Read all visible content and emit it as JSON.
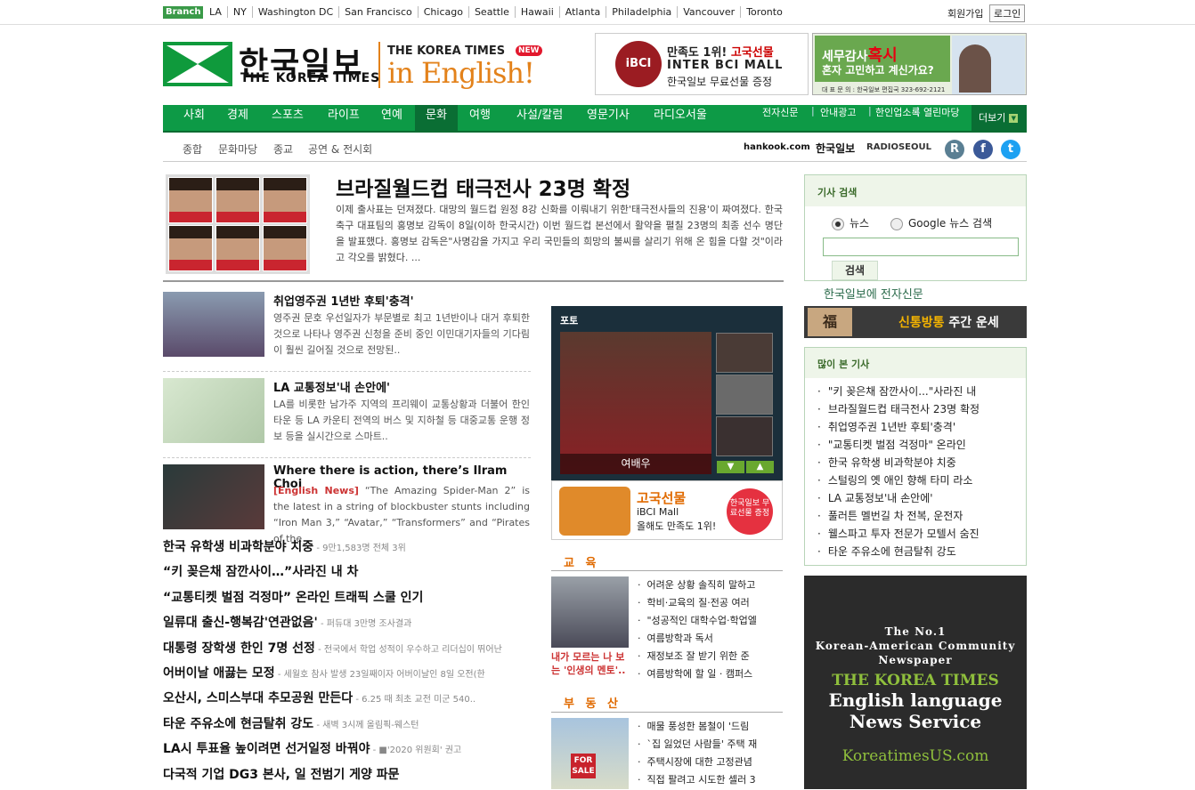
{
  "topbar": {
    "branch": "Branch",
    "cities": [
      "LA",
      "NY",
      "Washington DC",
      "San Francisco",
      "Chicago",
      "Seattle",
      "Hawaii",
      "Atlanta",
      "Philadelphia",
      "Vancouver",
      "Toronto"
    ],
    "join": "회원가입",
    "login": "로그인"
  },
  "logo": {
    "korean": "한국일보",
    "english": "THE KOREA TIMES",
    "sub_title": "THE KOREA TIMES",
    "sub_script": "in English!",
    "new": "NEW"
  },
  "ad1": {
    "mark": "iBCI",
    "line1a": "만족도 1위!",
    "line1b": "고국선물",
    "line2": "INTER BCI MALL",
    "line3": "한국일보 무료선물 증정"
  },
  "ad2": {
    "line1a": "세무감사",
    "line1b": "혹시",
    "line2": "혼자 고민하고 계신가요?",
    "line3": "대 표 문 의 : 한국일보 편집국 323-692-2121"
  },
  "nav": {
    "main": [
      "사회",
      "경제",
      "스포츠",
      "라이프",
      "연예",
      "문화",
      "여행",
      "사설/칼럼",
      "영문기사",
      "라디오서울"
    ],
    "right": [
      "전자신문",
      "안내광고",
      "한인업소록",
      "열린마당"
    ],
    "more": "더보기"
  },
  "subnav": {
    "items": [
      "종합",
      "문화마당",
      "종교",
      "공연 & 전시회"
    ],
    "brands": [
      "hankook.com",
      "한국일보",
      "RADIOSEOUL"
    ]
  },
  "top_story": {
    "title": "브라질월드컵 태극전사 23명 확정",
    "body": "이제 출사표는 던져졌다. 대망의 월드컵 원정 8강 신화를 이뤄내기 위한'태극전사들의 진용'이 짜여졌다. 한국 축구 대표팀의 홍명보 감독이 8일(이하 한국시간) 이번 월드컵 본선에서 활약을 펼칠 23명의 최종 선수 명단을 발표했다. 홍명보 감독은\"사명감을 가지고 우리 국민들의 희망의 불씨를 살리기 위해 온 힘을 다할 것\"이라고 각오를 밝혔다. ..."
  },
  "stories": [
    {
      "title": "취업영주권 1년반 후퇴'충격'",
      "body": "영주권 문호 우선일자가 부문별로 최고 1년반이나 대거 후퇴한 것으로 나타나 영주권 신청을 준비 중인 이민대기자들의 기다림이 훨씬 길어질 것으로 전망된.."
    },
    {
      "title": "LA 교통정보'내 손안에'",
      "body": "LA를 비롯한 남가주 지역의 프리웨이 교통상황과 더불어 한인타운 등 LA 카운티 전역의 버스 및 지하철 등 대중교통 운행 정보 등을 실시간으로 스마트.."
    },
    {
      "title": "Where there is action, there’s Ilram Choi",
      "tag": "[English News]",
      "body": " “The Amazing Spider-Man 2” is the latest in a string of blockbuster stunts including “Iron Man 3,” “Avatar,” “Transformers” and “Pirates of the"
    }
  ],
  "headlines": [
    {
      "h": "한국 유학생 비과학분야 치중",
      "s": " - 9만1,583명 전체 3위"
    },
    {
      "h": "“키 꽂은채 잠깐사이…”사라진 내 차",
      "s": ""
    },
    {
      "h": "“교통티켓 벌점 걱정마” 온라인 트래픽 스쿨 인기",
      "s": ""
    },
    {
      "h": "일류대 출신-행복감'연관없음'",
      "s": " - 퍼듀대 3만명 조사결과"
    },
    {
      "h": "대통령 장학생 한인 7명 선정",
      "s": " - 전국에서 학업 성적이 우수하고 리더십이 뛰어난"
    },
    {
      "h": "어버이날 애끓는 모정",
      "s": " - 세월호 참사 발생 23일째이자 어버이날인 8일 오전(한"
    },
    {
      "h": "오산시, 스미스부대 추모공원 만든다",
      "s": " - 6.25 때 최초 교전 미군 540.."
    },
    {
      "h": "타운 주유소에 현금탈취 강도",
      "s": " - 새벽 3시께 올림픽-웨스턴"
    },
    {
      "h": "LA시 투표율 높이려면 선거일정 바꿔야",
      "s": " - ■'2020 위원회' 권고"
    },
    {
      "h": "다국적 기업 DG3 본사, 일 전범기 게양 파문",
      "s": ""
    }
  ],
  "photo": {
    "label": "포토",
    "caption": "여배우"
  },
  "ad3": {
    "t1": "고국선물",
    "t2": "iBCI Mall",
    "t3": "올해도 만족도 1위!",
    "circle": "한국일보 무료선물 증정"
  },
  "education": {
    "title": "교 육",
    "caption": "내가 모르는 나 보는 '인생의 멘토'..",
    "items": [
      "어려운 상황 솔직히 말하고",
      "학비·교육의 질·전공 여러",
      "\"성공적인 대학수업·학업엘",
      "여름방학과 독서",
      "재정보조 잘 받기 위한 준",
      "여름방학에 할 일 · 캠퍼스"
    ]
  },
  "realestate": {
    "title": "부 동 산",
    "sign": "FOR SALE",
    "items": [
      "매물 풍성한 봄철이 '드림",
      "`집 잃었던 사람들' 주택 재",
      "주택시장에 대한 고정관념",
      "직접 팔려고 시도한 셀러 3"
    ]
  },
  "search": {
    "header": "기사 검색",
    "opt1": "뉴스",
    "opt2": "Google 뉴스 검색",
    "button": "검색"
  },
  "epaper": "한국일보에 전자신문",
  "fortune": {
    "icon": "福",
    "t1": "신통방통",
    "t2": " 주간 운세"
  },
  "popular": {
    "header": "많이 본 기사",
    "items": [
      "\"키 꽂은채 잠깐사이...\"사라진 내",
      "브라질월드컵 태극전사 23명 확정",
      "취업영주권 1년반 후퇴'충격'",
      "\"교통티켓 벌점 걱정마\" 온라인",
      "한국 유학생 비과학분야 치중",
      "스털링의 옛 애인 향해 타미 라소",
      "LA 교통정보'내 손안에'",
      "풀러튼 멜번길 차 전복, 운전자",
      "웰스파고 투자 전문가 모텔서 숨진",
      "타운 주유소에 현금탈취 강도"
    ]
  },
  "ktad": {
    "l1": "The No.1",
    "l2": "Korean-American Community",
    "l3": "Newspaper",
    "kt": "THE KOREA TIMES",
    "el1": "English language",
    "el2": "News Service",
    "url": "KoreatimesUS.com"
  },
  "colors": {
    "nav": "#0d9a46",
    "accent": "#e3821b",
    "section": "#e06a00"
  }
}
